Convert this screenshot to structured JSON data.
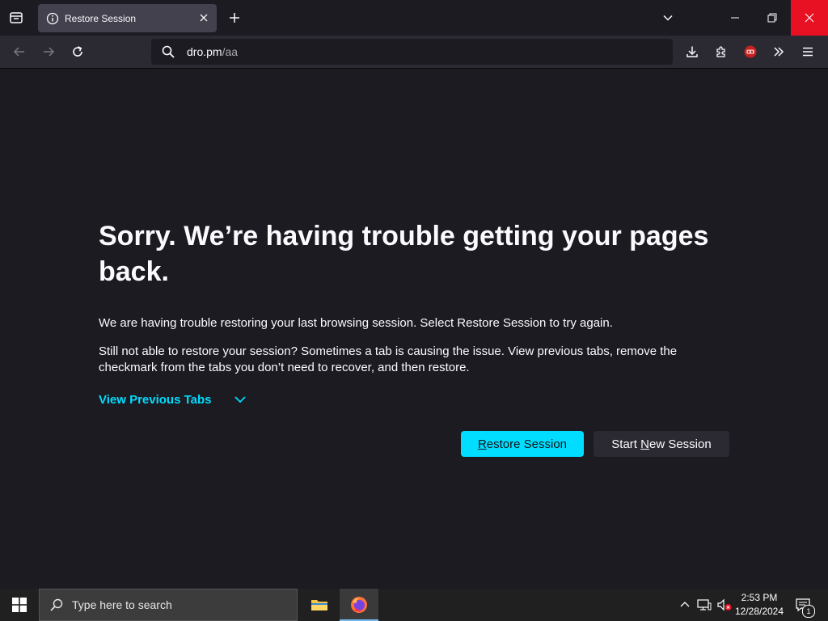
{
  "browser": {
    "tab": {
      "title": "Restore Session"
    },
    "url": {
      "host": "dro.pm",
      "path": "/aa"
    }
  },
  "page": {
    "title": "Sorry. We’re having trouble getting your pages back.",
    "paragraph1": "We are having trouble restoring your last browsing session. Select Restore Session to try again.",
    "paragraph2": "Still not able to restore your session? Sometimes a tab is causing the issue. View previous tabs, remove the checkmark from the tabs you don’t need to recover, and then restore.",
    "view_previous_tabs": "View Previous Tabs",
    "restore_button": {
      "accel": "R",
      "rest": "estore Session"
    },
    "new_session_button": {
      "before": "Start ",
      "accel": "N",
      "after": "ew Session"
    },
    "accent_color": "#00ddff"
  },
  "taskbar": {
    "search_placeholder": "Type here to search",
    "time": "2:53 PM",
    "date": "12/28/2024",
    "notification_count": "1"
  }
}
